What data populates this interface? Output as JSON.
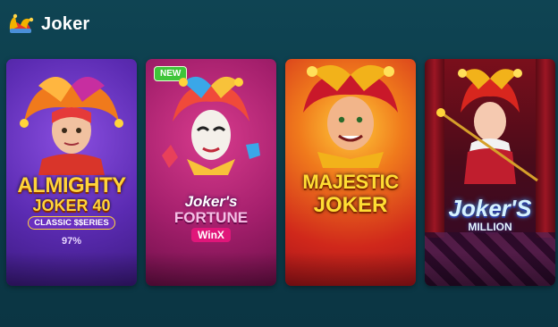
{
  "header": {
    "title": "Joker",
    "icon": "jester-hat-icon"
  },
  "games": [
    {
      "name": "ALMIGHTY",
      "line2": "JOKER 40",
      "line3": "CLASSIC $$ERIES",
      "stat": "97%",
      "badge": ""
    },
    {
      "name": "Joker's",
      "line2": "FORTUNE",
      "line3": "WinX",
      "badge": "NEW"
    },
    {
      "name": "MAJESTIC",
      "line2": "JOKER",
      "badge": ""
    },
    {
      "name": "Joker'S",
      "line2": "MILLION",
      "badge": ""
    }
  ],
  "colors": {
    "background": "#0c3a48",
    "new_badge": "#3fc53a"
  }
}
